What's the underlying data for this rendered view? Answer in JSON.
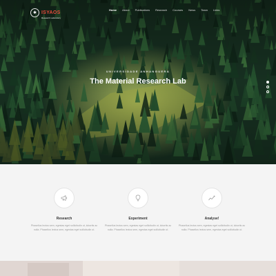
{
  "brand": {
    "name": "ISYAOS",
    "tagline": "Research Laboratory"
  },
  "nav": {
    "items": [
      {
        "label": "Home",
        "active": true
      },
      {
        "label": "About",
        "active": false
      },
      {
        "label": "Publications",
        "active": false
      },
      {
        "label": "Research",
        "active": false
      },
      {
        "label": "Courses",
        "active": false
      },
      {
        "label": "News",
        "active": false
      },
      {
        "label": "Team",
        "active": false
      },
      {
        "label": "Links",
        "active": false
      }
    ]
  },
  "hero": {
    "subtitle": "UNIVERSIDADE ANHANGUERA",
    "title": "The Material Research Lab",
    "slides_total": 3,
    "active_slide": 1
  },
  "features": [
    {
      "icon": "megaphone-icon",
      "title": "Research",
      "text": "Phasellus lectus sem, egestas eget sollicitudin ut, lobortis ac nulla. Phasellus lectus sem, egestas eget sollicitudin ut."
    },
    {
      "icon": "lightbulb-icon",
      "title": "Experiment",
      "text": "Phasellus lectus sem, egestas eget sollicitudin ut, lobortis ac nulla. Phasellus lectus sem, egestas eget sollicitudin ut."
    },
    {
      "icon": "chart-line-icon",
      "title": "Analyse!",
      "text": "Phasellus lectus sem, egestas eget sollicitudin ut, lobortis ac nulla. Phasellus lectus sem, egestas eget sollicitudin ut."
    }
  ],
  "colors": {
    "accent": "#e64b3c",
    "hero_dark": "#0f1d12",
    "section_bg": "#f4f4f4"
  }
}
